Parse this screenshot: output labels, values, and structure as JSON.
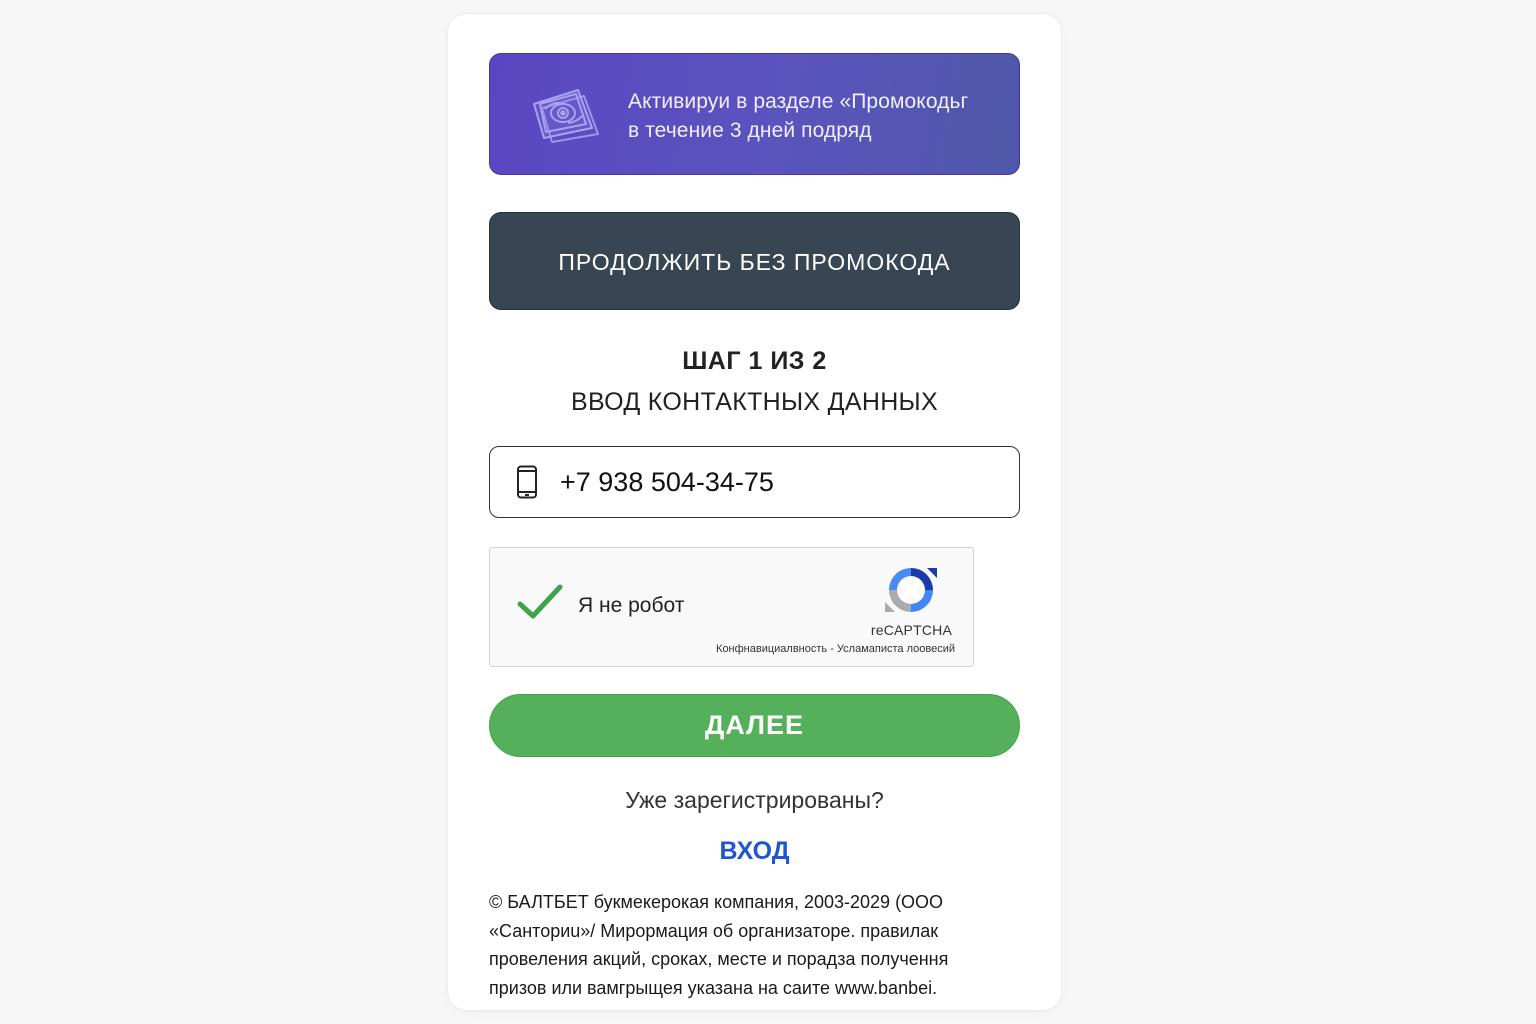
{
  "promo": {
    "line1": "Активируи в разделе «Промокодьг",
    "line2": "в течение 3 дней подряд",
    "icon": "money-icon"
  },
  "no_promo_label": "ПРОДОЛЖИТЬ БЕЗ ПРОМОКОДА",
  "step": {
    "title": "ШАГ 1 ИЗ 2",
    "subtitle": "ВВОД КОНТАКТНЫХ ДАННЫХ"
  },
  "phone": {
    "value": "+7 938 504-34-75",
    "icon": "phone-icon"
  },
  "captcha": {
    "label": "Я не робот",
    "brand": "reCAPTCHA",
    "links": "Конфнавициалвность - Усламаписта лоовесий",
    "checked": true
  },
  "next_label": "ДАЛЕЕ",
  "already_registered": "Уже зарегистрированы?",
  "login_label": "ВХОД",
  "footer": {
    "lines": [
      "© БАЛТБЕТ букмекерокая компания, 2003-2029 (ООО",
      "«Санториu»/ Мирормация об организаторе. правилак",
      "провеления акций, сроках, месте и порадза получення",
      "призов или вамгрыщея указана на саите www.banbei."
    ]
  },
  "colors": {
    "promo_gradient_start": "#5b46c2",
    "promo_gradient_end": "#4f58a8",
    "dark_button": "#384552",
    "next_button": "#55b05c",
    "login_link": "#1e56d0",
    "captcha_check": "#3fa34d"
  }
}
